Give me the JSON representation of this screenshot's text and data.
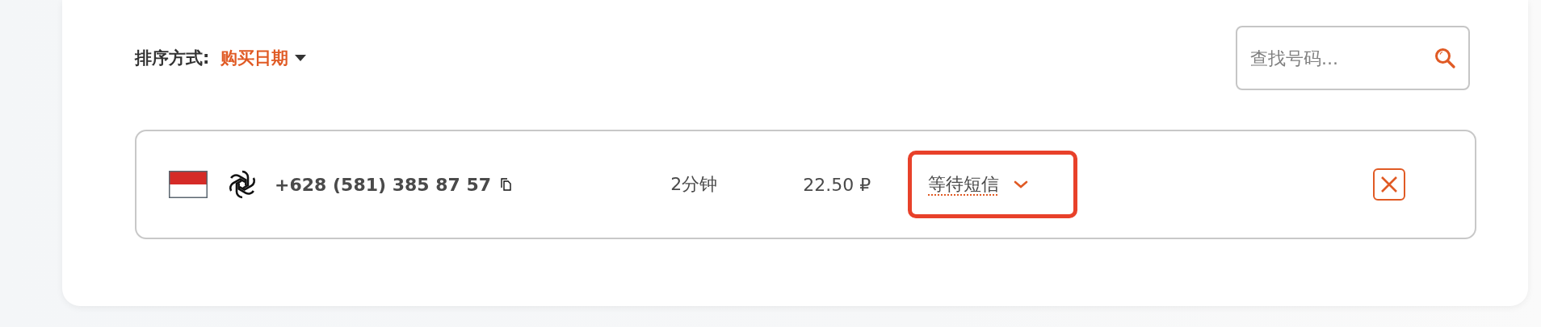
{
  "sort": {
    "label": "排序方式:",
    "value": "购买日期"
  },
  "search": {
    "placeholder": "查找号码..."
  },
  "rows": [
    {
      "phone": "+628 (581) 385 87 57",
      "duration": "2分钟",
      "price": "22.50 ₽",
      "status": "等待短信"
    }
  ]
}
